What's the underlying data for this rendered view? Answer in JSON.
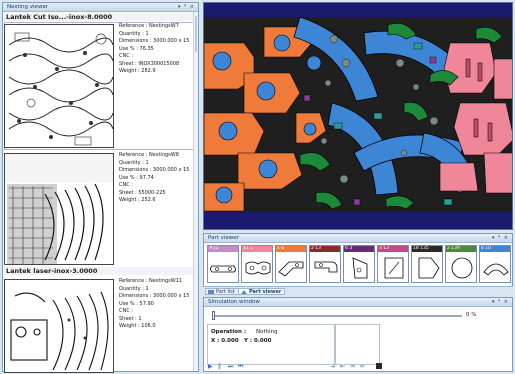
{
  "colors": {
    "title_text": "#1d3a66",
    "canvas_bg": "#1a1a6e",
    "part_blue": "#3d86d6",
    "part_orange": "#f07a3a",
    "part_pink": "#f0869a",
    "part_green": "#1d8a3a",
    "purple": "#8a3a9a"
  },
  "nesting_viewer": {
    "title": "Nesting viewer",
    "pane_buttons": "▾ ᵠ ×",
    "groups": [
      {
        "header": "Lantek Cut Iso...-inox-8.0000",
        "sheets": [
          {
            "reference": "Reference : NestingsW7",
            "quantity": "Quantity : 1",
            "dimensions": "Dimensions : 3000.000 x 15",
            "use": "Use % : 76.35",
            "cnc": "CNC :",
            "sheet": "Sheet : INOX300015008",
            "weight": "Weight : 282.9"
          },
          {
            "reference": "Reference : NestingsW8",
            "quantity": "Quantity : 1",
            "dimensions": "Dimensions : 3000.000 x 15",
            "use": "Use % : 97.74",
            "cnc": "CNC :",
            "sheet": "Sheet : 55000-225",
            "weight": "Weight : 252.6"
          }
        ]
      },
      {
        "header": "Lantek laser-inox-3.0000",
        "sheets": [
          {
            "reference": "Reference : NestingsW11",
            "quantity": "Quantity : 1",
            "dimensions": "Dimensions : 3000.000 x 15",
            "use": "Use % : 57.90",
            "cnc": "CNC :",
            "sheet": "Sheet : 1",
            "weight": "Weight : 106.0"
          }
        ]
      }
    ]
  },
  "part_viewer": {
    "title": "Part viewer",
    "pane_buttons": "▾ ᵠ ×",
    "parts": [
      {
        "label": "#11",
        "color": "#c58ac9",
        "icon": "flat-bar-part"
      },
      {
        "label": "11 1",
        "color": "#f0869a",
        "icon": "link-part"
      },
      {
        "label": "1 6",
        "color": "#f07a3a",
        "icon": "arm-part"
      },
      {
        "label": "2 13",
        "color": "#8a2a2a",
        "icon": "hook-part"
      },
      {
        "label": "6 3",
        "color": "#6a2a7a",
        "icon": "triangle-part"
      },
      {
        "label": "3 13",
        "color": "#c24a8a",
        "icon": "rect-part"
      },
      {
        "label": "18 135",
        "color": "#2a2a2a",
        "icon": "polygon-part"
      },
      {
        "label": "2 139",
        "color": "#4a8a3a",
        "icon": "circle-part"
      },
      {
        "label": "8 10",
        "color": "#3d86d6",
        "icon": "arc-part"
      }
    ],
    "tabs": [
      {
        "label": "Part list",
        "icon": "list-icon"
      },
      {
        "label": "Part viewer",
        "icon": "viewer-icon"
      }
    ]
  },
  "simulation": {
    "title": "Simulation window",
    "pane_buttons": "▾ ᵠ ×",
    "progress_percent": 0,
    "progress_label": "0 %",
    "operation_label": "Operation :",
    "operation_value": "Nothing",
    "x_label": "X : 0.000",
    "y_label": "Y : 0.000",
    "controls": [
      "▶",
      "‖",
      "⏭",
      "⏮"
    ],
    "controls_right": [
      "⇥",
      "⇤",
      "⇒",
      "⇐"
    ]
  }
}
